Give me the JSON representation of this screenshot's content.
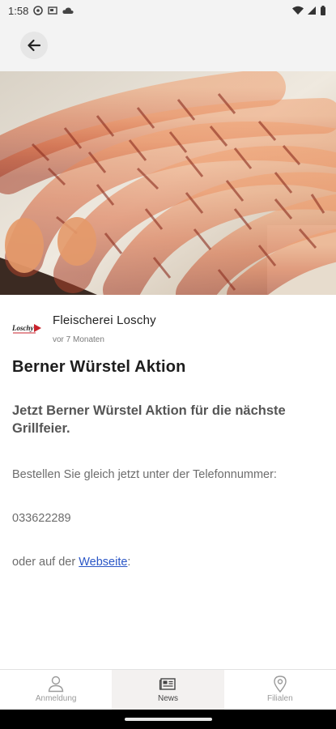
{
  "status_bar": {
    "time": "1:58",
    "icons": [
      "settings-status-icon",
      "screenshot-status-icon",
      "cloud-status-icon",
      "wifi-icon",
      "signal-icon",
      "battery-icon"
    ]
  },
  "app_bar": {
    "back_icon": "arrow-left-icon"
  },
  "hero": {
    "image": "bacon-wrapped-sausages-photo"
  },
  "post": {
    "author_name": "Fleischerei Loschy",
    "logo_text": "Loschy",
    "time_ago": "vor 7 Monaten",
    "title": "Berner Würstel Aktion",
    "lead": "Jetzt Berner Würstel Aktion für die nächste Grillfeier.",
    "paragraph_1": "Bestellen Sie gleich jetzt unter der Telefonnummer:",
    "phone": "033622289",
    "paragraph_3_prefix": "oder auf der ",
    "link_label": "Webseite",
    "paragraph_3_suffix": ":"
  },
  "bottom_nav": {
    "items": [
      {
        "label": "Anmeldung",
        "icon": "person-icon",
        "active": false
      },
      {
        "label": "News",
        "icon": "newspaper-icon",
        "active": true
      },
      {
        "label": "Filialen",
        "icon": "location-pin-icon",
        "active": false
      }
    ]
  },
  "colors": {
    "app_bar_bg": "#f3f3f3",
    "link": "#2a56c6",
    "logo_red": "#c8232c"
  }
}
